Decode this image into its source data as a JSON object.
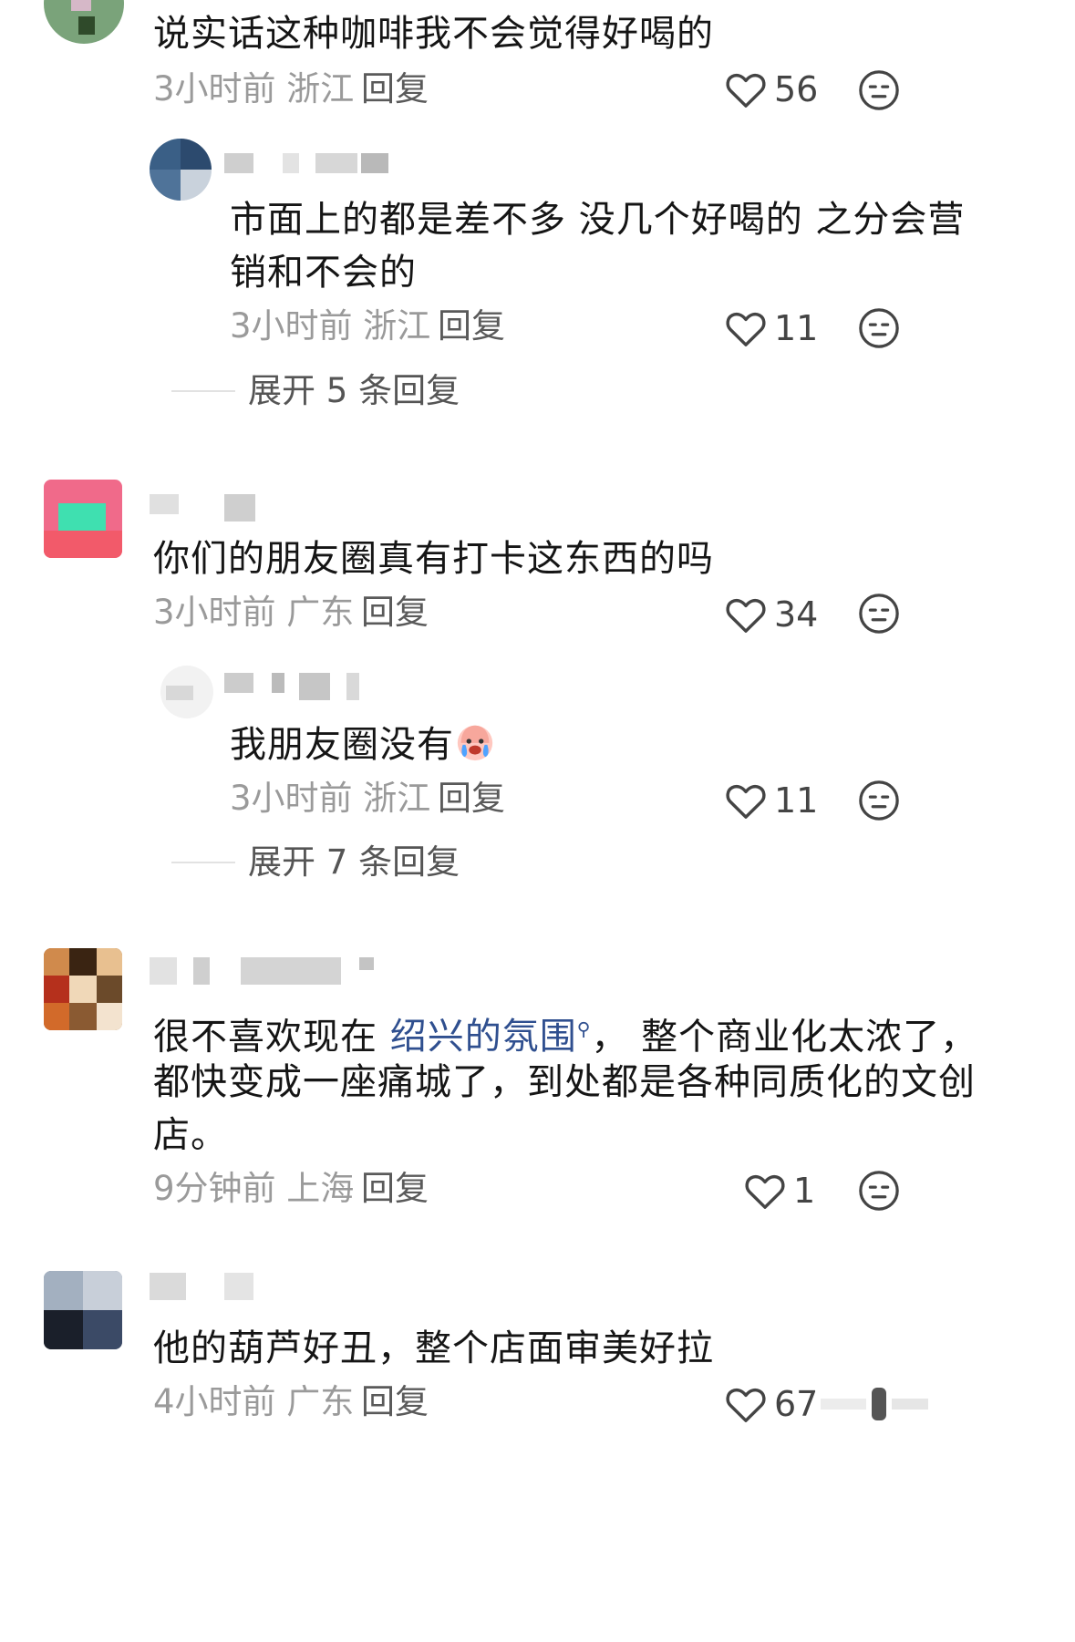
{
  "comments": [
    {
      "text": "说实话这种咖啡我不会觉得好喝的",
      "meta": "3小时前 浙江",
      "reply_label": "回复",
      "likes": "56",
      "replies": [
        {
          "text_line1": "市面上的都是差不多 没几个好喝的 之分会营",
          "text_line2": "销和不会的",
          "meta": "3小时前 浙江",
          "reply_label": "回复",
          "likes": "11"
        }
      ],
      "expand_label": "展开 5 条回复"
    },
    {
      "text": "你们的朋友圈真有打卡这东西的吗",
      "meta": "3小时前 广东",
      "reply_label": "回复",
      "likes": "34",
      "replies": [
        {
          "text": "我朋友圈没有",
          "meta": "3小时前 浙江",
          "reply_label": "回复",
          "likes": "11"
        }
      ],
      "expand_label": "展开 7 条回复"
    },
    {
      "text_pre": "很不喜欢现在 ",
      "link": "绍兴的氛围",
      "link_icon": "search-icon",
      "text_post": "， 整个商业化太浓了，",
      "text_line2": "都快变成一座痛城了，到处都是各种同质化的文创",
      "text_line3": "店。",
      "meta": "9分钟前 上海",
      "reply_label": "回复",
      "likes": "1"
    },
    {
      "text": "他的葫芦好丑，整个店面审美好拉",
      "meta": "4小时前 广东",
      "reply_label": "回复",
      "likes": "67"
    }
  ],
  "colors": {
    "text": "#151515",
    "meta": "#9a9a9a",
    "link": "#2f4f8f",
    "icon": "#444444"
  },
  "icons": {
    "like": "heart-icon",
    "dislike": "sleepy-face-icon",
    "crying": "crying-emoji-icon"
  }
}
